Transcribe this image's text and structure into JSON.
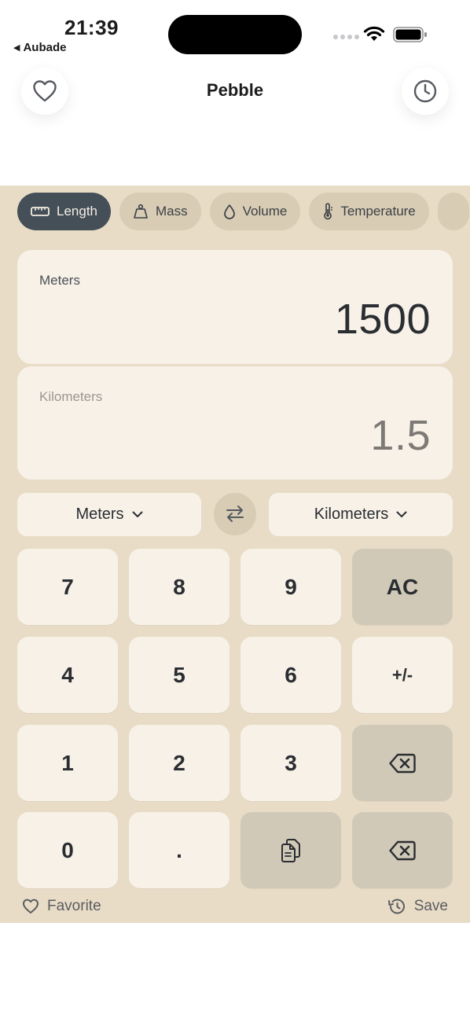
{
  "status": {
    "time": "21:39",
    "back_app": "Aubade"
  },
  "header": {
    "title": "Pebble",
    "left_icon": "heart-icon",
    "right_icon": "clock-icon"
  },
  "categories": [
    {
      "label": "Length",
      "icon": "ruler-icon",
      "active": true
    },
    {
      "label": "Mass",
      "icon": "weight-icon",
      "active": false
    },
    {
      "label": "Volume",
      "icon": "drop-icon",
      "active": false
    },
    {
      "label": "Temperature",
      "icon": "thermometer-icon",
      "active": false
    }
  ],
  "conversion": {
    "from_label": "Meters",
    "from_value": "1500",
    "to_label": "Kilometers",
    "to_value": "1.5"
  },
  "units": {
    "from": "Meters",
    "to": "Kilometers",
    "swap_icon": "swap-arrows-icon"
  },
  "keypad": {
    "k7": "7",
    "k8": "8",
    "k9": "9",
    "ac": "AC",
    "k4": "4",
    "k5": "5",
    "k6": "6",
    "sign": "+/-",
    "k1": "1",
    "k2": "2",
    "k3": "3",
    "k0": "0",
    "dot": "."
  },
  "footer": {
    "favorite": "Favorite",
    "save": "Save"
  },
  "colors": {
    "panel": "#e8dcc6",
    "card": "#f7f1e8",
    "chip": "#d8ccb5",
    "chip_active": "#454f58",
    "key_dark": "#d0c9b8"
  }
}
